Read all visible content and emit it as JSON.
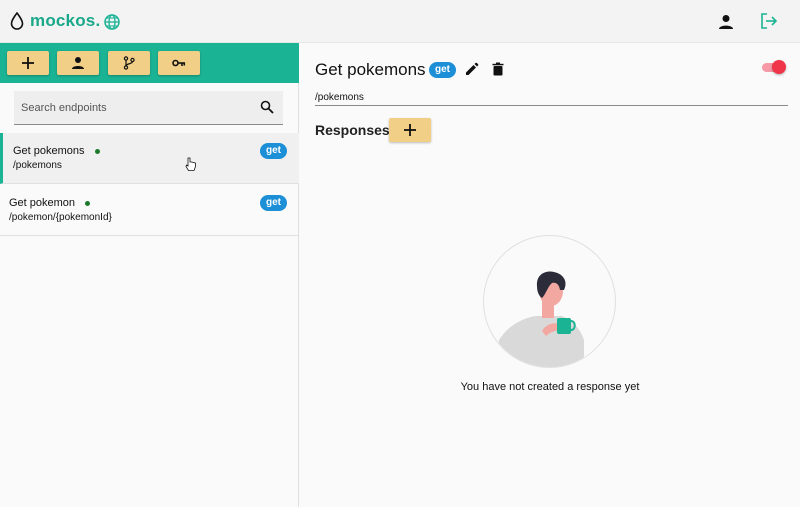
{
  "app": {
    "name": "mockos."
  },
  "header": {
    "icons": [
      "drop-logo-icon",
      "globe-icon",
      "user-icon",
      "logout-icon"
    ]
  },
  "sidebar": {
    "toolbar": [
      "add-icon",
      "user-icon",
      "branch-icon",
      "key-icon"
    ],
    "search": {
      "placeholder": "Search endpoints",
      "value": ""
    },
    "endpoints": [
      {
        "name": "Get pokemons",
        "path": "/pokemons",
        "method": "get",
        "active": true,
        "status": "enabled"
      },
      {
        "name": "Get pokemon",
        "path": "/pokemon/{pokemonId}",
        "method": "get",
        "active": false,
        "status": "enabled"
      }
    ]
  },
  "main": {
    "title": "Get pokemons",
    "method": "get",
    "path": "/pokemons",
    "enabled": true,
    "responses_label": "Responses",
    "empty_message": "You have not created a response yet"
  },
  "colors": {
    "accent": "#1ab394",
    "button": "#f1cf86",
    "badge": "#1c8fd6",
    "status_dot": "#1d7a2c",
    "toggle": "#f0354b"
  }
}
